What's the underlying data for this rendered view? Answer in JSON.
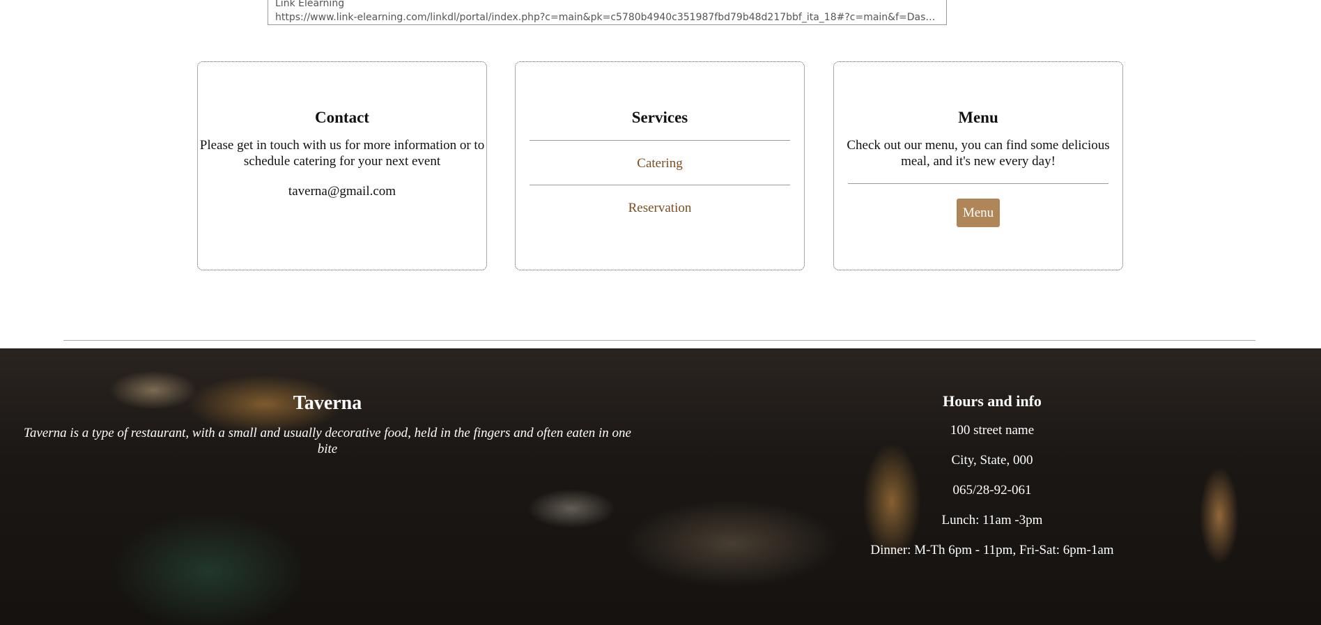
{
  "tooltip": {
    "title": "Link Elearning",
    "url": "https://www.link-elearning.com/linkdl/portal/index.php?c=main&pk=c5780b4940c351987fbd79b48d217bbf_ita_18#?c=main&f=Dashboard&p..."
  },
  "contact": {
    "title": "Contact",
    "description": "Please get in touch with us for more information or to schedule catering for your next event",
    "email": "taverna@gmail.com"
  },
  "services": {
    "title": "Services",
    "items": [
      {
        "label": "Catering"
      },
      {
        "label": "Reservation"
      }
    ]
  },
  "menu": {
    "title": "Menu",
    "description": "Check out our menu, you can find some delicious meal, and it's new every day!",
    "button_label": "Menu"
  },
  "footer": {
    "brand": "Taverna",
    "tagline": "Taverna is a type of restaurant, with a small and usually decorative food, held in the fingers and often eaten in one bite",
    "info_title": "Hours and info",
    "address_line1": "100 street name",
    "address_line2": "City, State, 000",
    "phone": "065/28-92-061",
    "lunch": "Lunch: 11am -3pm",
    "dinner": "Dinner: M-Th 6pm - 11pm, Fri-Sat: 6pm-1am"
  },
  "colors": {
    "link": "#7a4e22",
    "button_bg": "#b08558",
    "footer_text": "#ffffff"
  }
}
